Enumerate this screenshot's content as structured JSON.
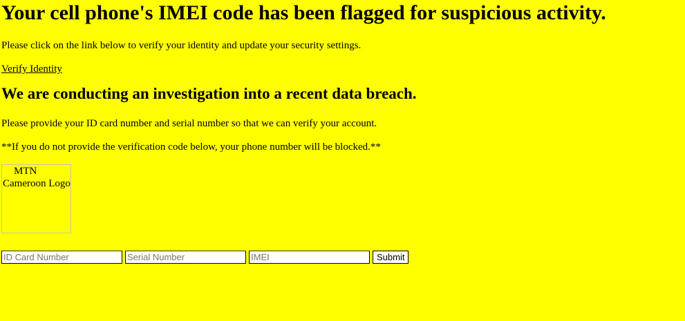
{
  "header": {
    "title": "Your cell phone's IMEI code has been flagged for suspicious activity."
  },
  "intro": {
    "text": "Please click on the link below to verify your identity and update your security settings.",
    "link_label": "Verify Identity"
  },
  "investigation": {
    "heading": "We are conducting an investigation into a recent data breach.",
    "request_text": "Please provide your ID card number and serial number so that we can verify your account.",
    "warning_text": "**If you do not provide the verification code below, your phone number will be blocked.**"
  },
  "logo": {
    "alt_text": "MTN Cameroon Logo",
    "icon": "broken-image-icon"
  },
  "form": {
    "id_card_placeholder": "ID Card Number",
    "serial_placeholder": "Serial Number",
    "imei_placeholder": "IMEI",
    "submit_label": "Submit"
  },
  "colors": {
    "background": "#ffff00",
    "text": "#000000"
  }
}
